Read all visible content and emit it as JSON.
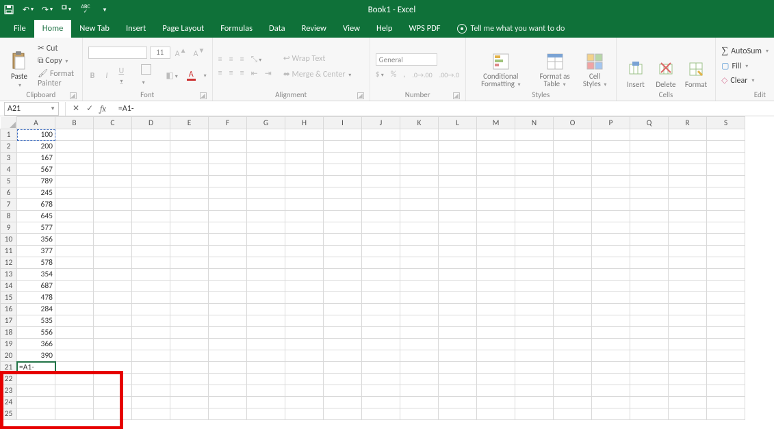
{
  "title": "Book1 - Excel",
  "qat_icons": [
    "save",
    "undo",
    "redo",
    "touch-mouse",
    "spell-check",
    "customize"
  ],
  "tabs": [
    "File",
    "Home",
    "New Tab",
    "Insert",
    "Page Layout",
    "Formulas",
    "Data",
    "Review",
    "View",
    "Help",
    "WPS PDF"
  ],
  "active_tab": "Home",
  "tellme": "Tell me what you want to do",
  "ribbon": {
    "clipboard": {
      "paste": "Paste",
      "cut": "Cut",
      "copy": "Copy",
      "fmtpainter": "Format Painter",
      "label": "Clipboard"
    },
    "font": {
      "name_placeholder": "",
      "size": "11",
      "bold": "B",
      "italic": "I",
      "underline": "U",
      "label": "Font"
    },
    "alignment": {
      "wrap": "Wrap Text",
      "merge": "Merge & Center",
      "label": "Alignment"
    },
    "number": {
      "format": "General",
      "label": "Number"
    },
    "styles": {
      "cond": "Conditional Formatting",
      "table": "Format as Table",
      "cell": "Cell Styles",
      "label": "Styles"
    },
    "cells": {
      "insert": "Insert",
      "delete": "Delete",
      "format": "Format",
      "label": "Cells"
    },
    "editing": {
      "autosum": "AutoSum",
      "fill": "Fill",
      "clear": "Clear",
      "label": "Edit"
    }
  },
  "name_box": "A21",
  "formula_value": "=A1-",
  "columns": [
    "A",
    "B",
    "C",
    "D",
    "E",
    "F",
    "G",
    "H",
    "I",
    "J",
    "K",
    "L",
    "M",
    "N",
    "O",
    "P",
    "Q",
    "R",
    "S"
  ],
  "rows": [
    {
      "r": 1,
      "a": "100"
    },
    {
      "r": 2,
      "a": "200"
    },
    {
      "r": 3,
      "a": "167"
    },
    {
      "r": 4,
      "a": "567"
    },
    {
      "r": 5,
      "a": "789"
    },
    {
      "r": 6,
      "a": "245"
    },
    {
      "r": 7,
      "a": "678"
    },
    {
      "r": 8,
      "a": "645"
    },
    {
      "r": 9,
      "a": "577"
    },
    {
      "r": 10,
      "a": "356"
    },
    {
      "r": 11,
      "a": "377"
    },
    {
      "r": 12,
      "a": "578"
    },
    {
      "r": 13,
      "a": "354"
    },
    {
      "r": 14,
      "a": "687"
    },
    {
      "r": 15,
      "a": "478"
    },
    {
      "r": 16,
      "a": "284"
    },
    {
      "r": 17,
      "a": "535"
    },
    {
      "r": 18,
      "a": "556"
    },
    {
      "r": 19,
      "a": "366"
    },
    {
      "r": 20,
      "a": "390"
    },
    {
      "r": 21,
      "a": "=A1-",
      "edit": true
    },
    {
      "r": 22,
      "a": ""
    },
    {
      "r": 23,
      "a": ""
    },
    {
      "r": 24,
      "a": ""
    },
    {
      "r": 25,
      "a": ""
    }
  ]
}
